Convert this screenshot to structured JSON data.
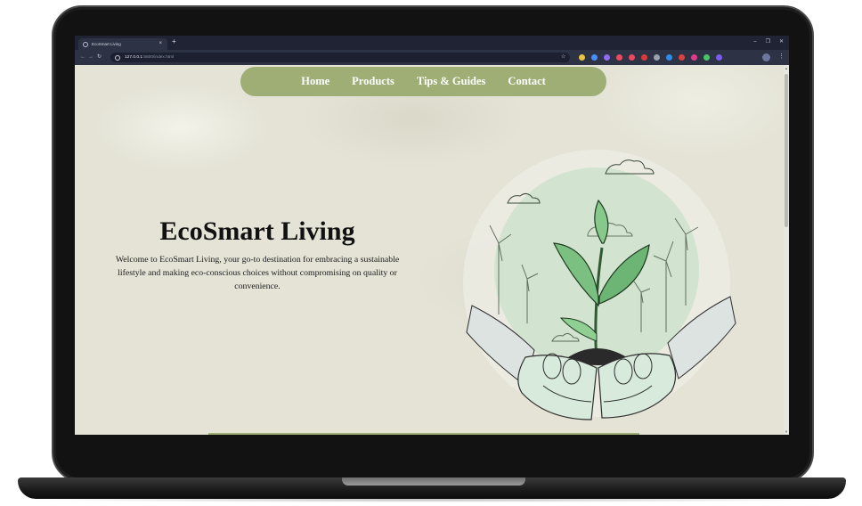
{
  "browser": {
    "tab_title": "EcoSmart Living",
    "tab_close": "×",
    "new_tab": "+",
    "window_controls": [
      "–",
      "❐",
      "✕"
    ],
    "url_host": "127.0.0.1",
    "url_rest": ":5500/index.html",
    "nav_icons": [
      "back-icon",
      "forward-icon",
      "reload-icon"
    ],
    "extension_colors": [
      "#e9c443",
      "#4c8df6",
      "#8f6bf0",
      "#e84a5f",
      "#e84a5f",
      "#d93a3a",
      "#9aa0ad",
      "#2f8ce8",
      "#d84242",
      "#e03c8c",
      "#49c46a",
      "#7a5cf0"
    ]
  },
  "nav": {
    "items": [
      "Home",
      "Products",
      "Tips & Guides",
      "Contact"
    ]
  },
  "hero": {
    "title": "EcoSmart Living",
    "description": "Welcome to EcoSmart Living, your go-to destination for embracing a sustainable lifestyle and making eco-conscious choices without compromising on quality or convenience."
  },
  "colors": {
    "accent": "#9fae74",
    "page_background": "#e4e3d6",
    "illustration_circle": "#cfe3cd",
    "leaf": "#7cc081"
  }
}
